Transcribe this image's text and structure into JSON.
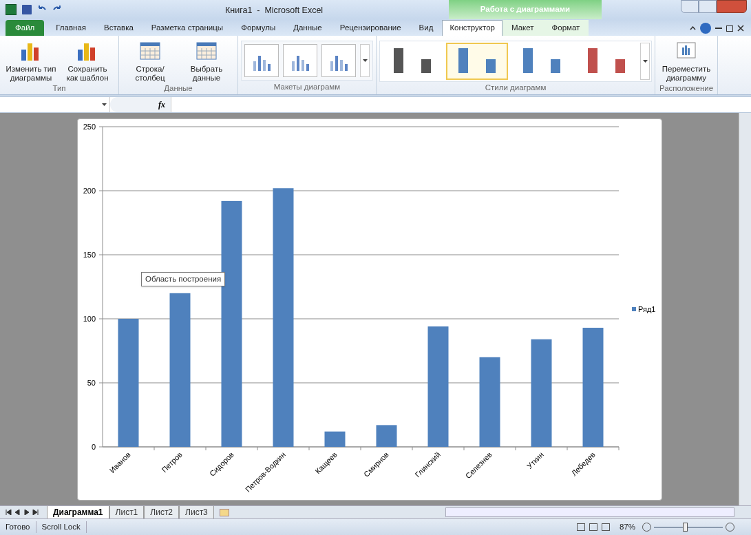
{
  "window": {
    "title": "Книга1  -  Microsoft Excel",
    "context_group": "Работа с диаграммами"
  },
  "tabs": [
    {
      "label": "Файл",
      "kind": "file",
      "selected": false
    },
    {
      "label": "Главная",
      "kind": "normal",
      "selected": false
    },
    {
      "label": "Вставка",
      "kind": "normal",
      "selected": false
    },
    {
      "label": "Разметка страницы",
      "kind": "normal",
      "selected": false
    },
    {
      "label": "Формулы",
      "kind": "normal",
      "selected": false
    },
    {
      "label": "Данные",
      "kind": "normal",
      "selected": false
    },
    {
      "label": "Рецензирование",
      "kind": "normal",
      "selected": false
    },
    {
      "label": "Вид",
      "kind": "normal",
      "selected": false
    },
    {
      "label": "Конструктор",
      "kind": "context",
      "selected": true
    },
    {
      "label": "Макет",
      "kind": "context",
      "selected": false
    },
    {
      "label": "Формат",
      "kind": "context",
      "selected": false
    }
  ],
  "ribbon": {
    "groups": [
      {
        "label": "Тип",
        "kind": "buttons",
        "buttons": [
          "Изменить тип диаграммы",
          "Сохранить как шаблон"
        ]
      },
      {
        "label": "Данные",
        "kind": "buttons",
        "buttons": [
          "Строка/столбец",
          "Выбрать данные"
        ]
      },
      {
        "label": "Макеты диаграмм",
        "kind": "layouts"
      },
      {
        "label": "Стили диаграмм",
        "kind": "styles",
        "styles": [
          {
            "color": "#555555",
            "selected": false
          },
          {
            "color": "#4f81bd",
            "selected": true
          },
          {
            "color": "#4f81bd",
            "selected": false
          },
          {
            "color": "#c0504d",
            "selected": false
          }
        ]
      },
      {
        "label": "Расположение",
        "kind": "buttons",
        "buttons": [
          "Переместить диаграмму"
        ]
      }
    ]
  },
  "formula_bar": {
    "fx": "fx"
  },
  "chart": {
    "tooltip": "Область построения",
    "chart_data": {
      "type": "bar",
      "categories": [
        "Иванов",
        "Петров",
        "Сидоров",
        "Петров-Водкин",
        "Кащеев",
        "Смирнов",
        "Глинский",
        "Селезнев",
        "Уткин",
        "Лебедев"
      ],
      "series": [
        {
          "name": "Ряд1",
          "color": "#4f81bd",
          "values": [
            100,
            120,
            192,
            202,
            12,
            17,
            94,
            70,
            84,
            93
          ]
        }
      ],
      "ylim": [
        0,
        250
      ],
      "yticks": [
        0,
        50,
        100,
        150,
        200,
        250
      ],
      "grid": true
    }
  },
  "sheet_tabs": [
    {
      "label": "Диаграмма1",
      "selected": true
    },
    {
      "label": "Лист1",
      "selected": false
    },
    {
      "label": "Лист2",
      "selected": false
    },
    {
      "label": "Лист3",
      "selected": false
    }
  ],
  "status_bar": {
    "items": [
      "Готово",
      "Scroll Lock"
    ],
    "zoom": "87%",
    "zoom_slider": {
      "level": 0.45
    }
  }
}
